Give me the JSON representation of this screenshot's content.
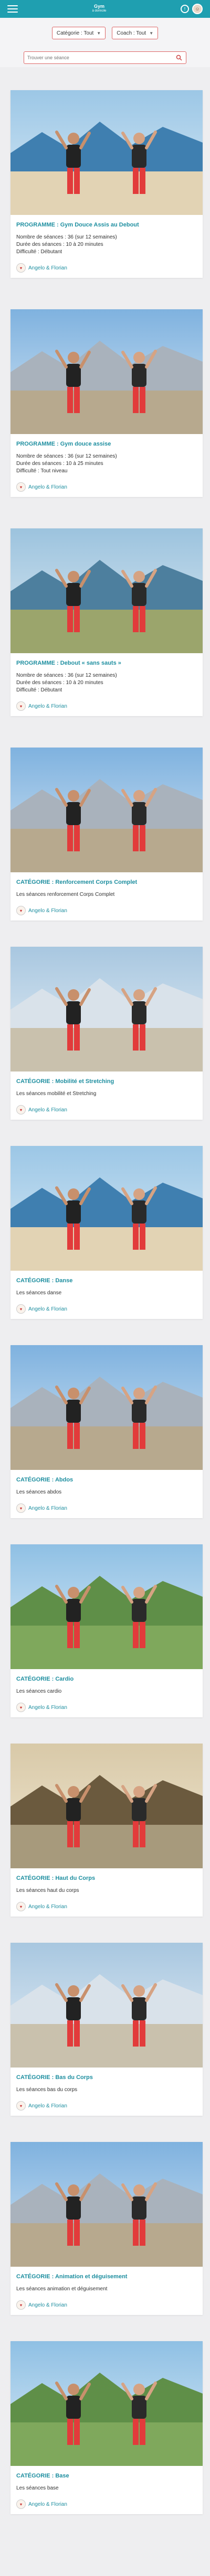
{
  "header": {
    "brand_line1": "Gym",
    "brand_line2": "à domicile",
    "notif": "!"
  },
  "filters": {
    "category_label": "Catégorie : Tout",
    "coach_label": "Coach : Tout",
    "search_placeholder": "Trouver une séance"
  },
  "cards": [
    {
      "title": "PROGRAMME : Gym Douce Assis au Debout",
      "lines": [
        "Nombre de séances : 36 (sur 12 semaines)",
        "Durée des séances : 10 à 20 minutes",
        "Difficulté : Débutant"
      ],
      "author": "Angelo & Florian",
      "scene": "beach"
    },
    {
      "title": "PROGRAMME : Gym douce assise",
      "lines": [
        "Nombre de séances : 36 (sur 12 semaines)",
        "Durée des séances : 10 à 25 minutes",
        "Difficulté : Tout niveau"
      ],
      "author": "Angelo & Florian",
      "scene": "mountain"
    },
    {
      "title": "PROGRAMME : Debout « sans sauts »",
      "lines": [
        "Nombre de séances : 36 (sur 12 semaines)",
        "Durée des séances : 10 à 20 minutes",
        "Difficulté : Débutant"
      ],
      "author": "Angelo & Florian",
      "scene": "lake"
    },
    {
      "title": "CATÉGORIE : Renforcement Corps Complet",
      "lines": [
        "Les séances renforcement Corps Complet"
      ],
      "author": "Angelo & Florian",
      "scene": "mountain"
    },
    {
      "title": "CATÉGORIE : Mobilité et Stretching",
      "lines": [
        "Les séances mobilité et Stretching"
      ],
      "author": "Angelo & Florian",
      "scene": "snow"
    },
    {
      "title": "CATÉGORIE : Danse",
      "lines": [
        "Les séances danse"
      ],
      "author": "Angelo & Florian",
      "scene": "beach"
    },
    {
      "title": "CATÉGORIE : Abdos",
      "lines": [
        "Les séances abdos"
      ],
      "author": "Angelo & Florian",
      "scene": "mountain"
    },
    {
      "title": "CATÉGORIE : Cardio",
      "lines": [
        "Les séances cardio"
      ],
      "author": "Angelo & Florian",
      "scene": "park"
    },
    {
      "title": "CATÉGORIE : Haut du Corps",
      "lines": [
        "Les séances haut du corps"
      ],
      "author": "Angelo & Florian",
      "scene": "forest"
    },
    {
      "title": "CATÉGORIE : Bas du Corps",
      "lines": [
        "Les séances bas du corps"
      ],
      "author": "Angelo & Florian",
      "scene": "snow"
    },
    {
      "title": "CATÉGORIE : Animation et déguisement",
      "lines": [
        "Les séances animation et déguisement"
      ],
      "author": "Angelo & Florian",
      "scene": "mountain"
    },
    {
      "title": "CATÉGORIE : Base",
      "lines": [
        "Les séances base"
      ],
      "author": "Angelo & Florian",
      "scene": "park"
    }
  ],
  "colors": {
    "accent": "#1f9fb0",
    "title": "#1f8fa0",
    "outline": "#dd6666"
  }
}
